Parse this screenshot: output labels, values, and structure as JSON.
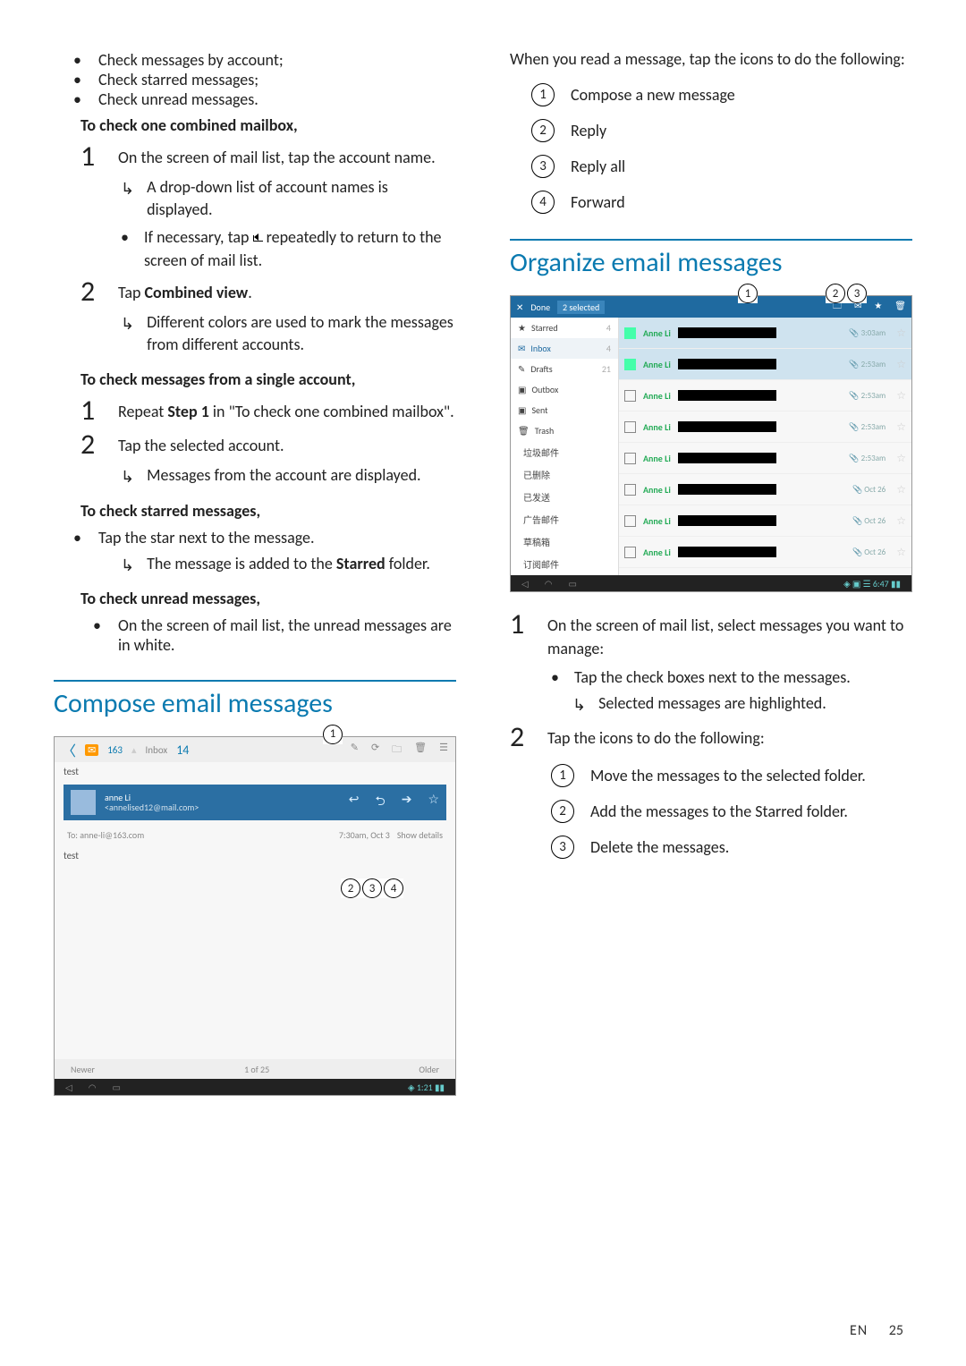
{
  "left": {
    "bullets_top": [
      "Check messages by account;",
      "Check starred messages;",
      "Check unread messages."
    ],
    "heading_combined": "To check one combined mailbox,",
    "step1_text_a": "On the screen of mail list, tap the account name.",
    "step1_arrow": "A drop-down list of account names is displayed.",
    "step1_bullet_a": "If necessary, tap ",
    "step1_bullet_b": " repeatedly to return to the screen of mail list.",
    "step2_lead": "Tap ",
    "step2_bold": "Combined view",
    "step2_tail": ".",
    "step2_arrow": "Different colors are used to mark the messages from different accounts.",
    "heading_single": "To check messages from a single account,",
    "single1_lead": "Repeat ",
    "single1_bold": "Step 1",
    "single1_tail": " in \"To check one combined mailbox\".",
    "single2": "Tap the selected account.",
    "single2_arrow": "Messages from the account are displayed.",
    "heading_starred": "To check starred messages,",
    "starred_line": "Tap the star next to the message.",
    "starred_arrow_a": "The message is added to the ",
    "starred_arrow_b": "Starred",
    "starred_arrow_c": " folder.",
    "heading_unread": "To check unread messages,",
    "unread_bullet": "On the screen of mail list, the unread messages are in white.",
    "section_compose": "Compose email messages",
    "compose_shot": {
      "account": "163",
      "inbox": "Inbox",
      "inbox_n": "14",
      "test": "test",
      "sender": "anne Li",
      "sender_addr": "<annelised12@mail.com>",
      "to": "To: anne-li@163.com",
      "date": "7:30am, Oct 3",
      "show": "Show details",
      "body": "test",
      "newer": "Newer",
      "pager": "1 of 25",
      "older": "Older",
      "clock": "1:21"
    }
  },
  "right": {
    "intro": "When you read a message, tap the icons to do the following:",
    "items": [
      "Compose a new message",
      "Reply",
      "Reply all",
      "Forward"
    ],
    "section_org": "Organize email messages",
    "org_shot": {
      "done": "Done",
      "sel": "2 selected",
      "side": [
        {
          "icon": "★",
          "label": "Starred",
          "badge": "4"
        },
        {
          "icon": "✉",
          "label": "Inbox",
          "badge": "4"
        },
        {
          "icon": "✎",
          "label": "Drafts",
          "badge": "21"
        },
        {
          "icon": "▣",
          "label": "Outbox",
          "badge": ""
        },
        {
          "icon": "▣",
          "label": "Sent",
          "badge": ""
        },
        {
          "icon": "🗑",
          "label": "Trash",
          "badge": ""
        },
        {
          "icon": "",
          "label": "垃圾邮件",
          "badge": ""
        },
        {
          "icon": "",
          "label": "已删除",
          "badge": ""
        },
        {
          "icon": "",
          "label": "已发送",
          "badge": ""
        },
        {
          "icon": "",
          "label": "广告邮件",
          "badge": ""
        },
        {
          "icon": "",
          "label": "草稿箱",
          "badge": ""
        },
        {
          "icon": "",
          "label": "订阅邮件",
          "badge": ""
        }
      ],
      "rows": [
        {
          "sel": true,
          "name": "Anne Li",
          "time": "3:03am"
        },
        {
          "sel": true,
          "name": "Anne Li",
          "time": "2:53am"
        },
        {
          "sel": false,
          "name": "Anne Li",
          "time": "2:53am"
        },
        {
          "sel": false,
          "name": "Anne Li",
          "time": "2:53am"
        },
        {
          "sel": false,
          "name": "Anne Li",
          "time": "2:53am"
        },
        {
          "sel": false,
          "name": "Anne Li",
          "time": "Oct 26"
        },
        {
          "sel": false,
          "name": "Anne Li",
          "time": "Oct 26"
        },
        {
          "sel": false,
          "name": "Anne Li",
          "time": "Oct 26"
        }
      ],
      "clock": "6:47"
    },
    "org_step1": "On the screen of mail list, select messages you want to manage:",
    "org_step1_b": "Tap the check boxes next to the messages.",
    "org_step1_arrow": "Selected messages are highlighted.",
    "org_step2": "Tap the icons to do the following:",
    "org_sub": [
      "Move the messages to the selected folder.",
      "Add the messages to the Starred folder.",
      "Delete the messages."
    ]
  },
  "footer": {
    "lang": "EN",
    "page": "25"
  }
}
